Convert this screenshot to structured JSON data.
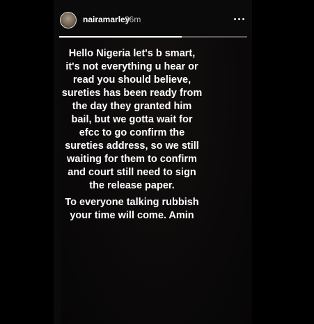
{
  "story": {
    "username": "nairamarley",
    "timestamp": "36m",
    "progress": 0.65,
    "more_icon": "more-horizontal-icon"
  },
  "caption": {
    "paragraphs": [
      "Hello Nigeria let's b smart, it's not everything u hear or read you should believe, sureties has been ready from the day they granted him bail, but we gotta wait for efcc to go confirm the sureties address, so we still waiting for them to confirm and court still need to sign the release paper.",
      "To everyone talking rubbish your time will come. Amin"
    ]
  }
}
